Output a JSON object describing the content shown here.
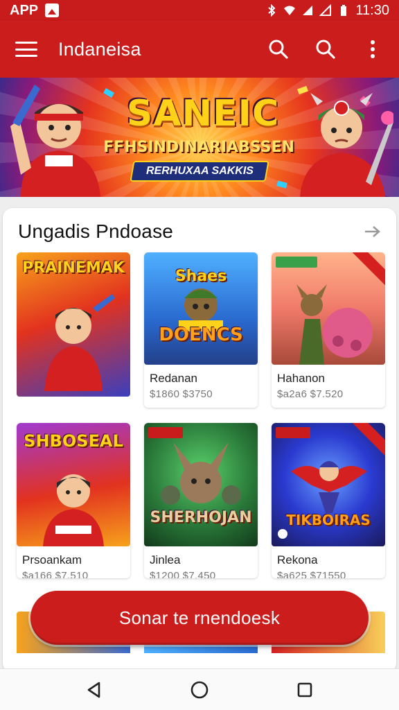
{
  "status_bar": {
    "app_label": "APP",
    "time": "11:30",
    "icons": [
      "app-icon",
      "bluetooth-icon",
      "wifi-icon",
      "signal-icon",
      "signal-icon",
      "battery-icon"
    ]
  },
  "app_bar": {
    "title": "Indaneisa",
    "actions": [
      "search-icon",
      "search-icon",
      "more-vert-icon"
    ]
  },
  "hero": {
    "title": "SANEIC",
    "subtitle": "FFHSINDINARIABSSEN",
    "tagline": "RERHUXAA SAKKIS"
  },
  "section": {
    "title": "Ungadis Pndoase",
    "arrow": "arrow-right-icon"
  },
  "games": [
    {
      "title_art": "PRAINEMAK",
      "name": "",
      "price": ""
    },
    {
      "title_art": "DOENCS",
      "title_art_top": "Shaes",
      "name": "Redanan",
      "price": "$1860 $3750"
    },
    {
      "title_art": "",
      "name": "Hahanon",
      "price": "$a2a6 $7.520"
    },
    {
      "title_art": "SHBOSEAL",
      "name": "Prsoankam",
      "price": "$a166 $7.510"
    },
    {
      "title_art": "SHERHOJAN",
      "name": "Jinlea",
      "price": "$1200 $7.450"
    },
    {
      "title_art": "TIKBOIRAS",
      "name": "Rekona",
      "price": "$a625 $71550"
    }
  ],
  "cta": {
    "label": "Sonar te rnendoesk"
  },
  "colors": {
    "primary": "#cc1d1d",
    "status": "#c81b1b",
    "accent_yellow": "#ffd21a"
  },
  "nav_bar": {
    "buttons": [
      "back-icon",
      "home-icon",
      "recents-icon"
    ]
  }
}
